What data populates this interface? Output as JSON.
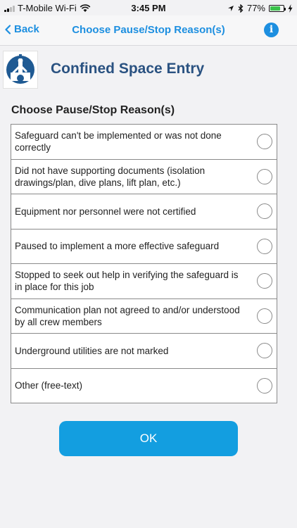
{
  "status_bar": {
    "carrier": "T-Mobile Wi-Fi",
    "time": "3:45 PM",
    "battery_percent": "77%",
    "battery_level": 0.77,
    "icons": [
      "signal-icon",
      "wifi-icon",
      "location-icon",
      "bluetooth-icon",
      "battery-icon",
      "charging-icon"
    ]
  },
  "nav": {
    "back_label": "Back",
    "title": "Choose Pause/Stop Reason(s)",
    "info_label": "i"
  },
  "header": {
    "app_title": "Confined Space Entry"
  },
  "section_title": "Choose Pause/Stop Reason(s)",
  "reasons": [
    {
      "label": "Safeguard can't be implemented or was not done correctly",
      "selected": false
    },
    {
      "label": "Did not have supporting documents (isolation drawings/plan, dive plans, lift plan, etc.)",
      "selected": false
    },
    {
      "label": "Equipment nor personnel were not certified",
      "selected": false
    },
    {
      "label": "Paused to implement a more effective safeguard",
      "selected": false
    },
    {
      "label": "Stopped to seek out help in verifying the safeguard is in place for this job",
      "selected": false
    },
    {
      "label": "Communication plan not agreed to and/or understood by all crew members",
      "selected": false
    },
    {
      "label": "Underground utilities are not marked",
      "selected": false
    },
    {
      "label": "Other (free-text)",
      "selected": false
    }
  ],
  "ok_label": "OK",
  "colors": {
    "accent": "#1d8fe0",
    "ok_button": "#139ee0",
    "header_title": "#2a5281",
    "logo_blue": "#1f5a93",
    "battery_green": "#3ac24a"
  }
}
